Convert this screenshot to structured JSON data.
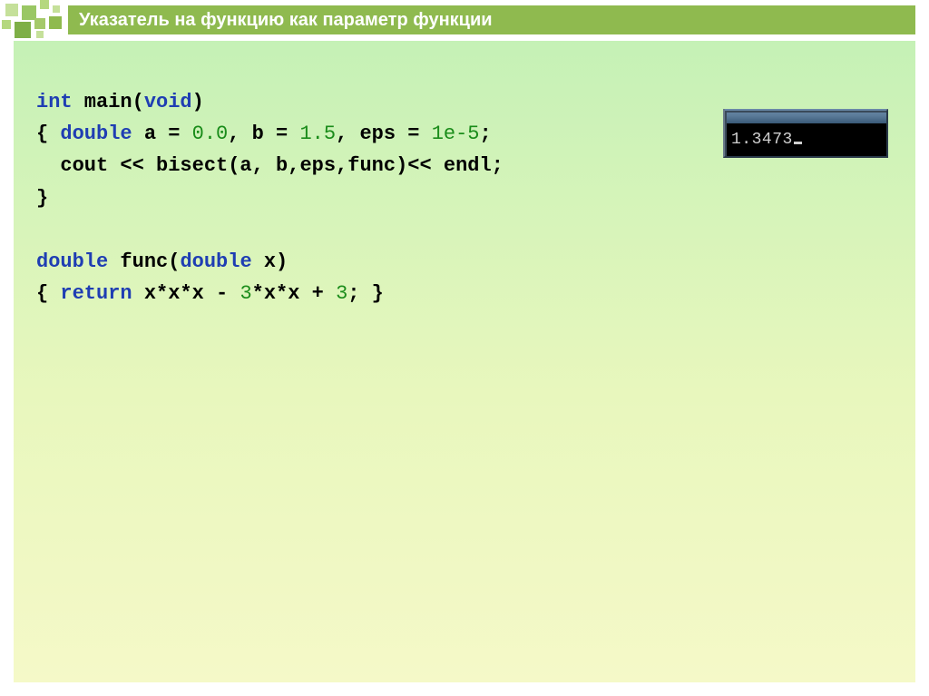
{
  "title": "Указатель на функцию как параметр функции",
  "code": {
    "l1": {
      "kw1": "int",
      "t1": " main(",
      "kw2": "void",
      "t2": ")"
    },
    "l2": {
      "t1": "{ ",
      "kw1": "double",
      "t2": " a = ",
      "n1": "0.0",
      "t3": ", b = ",
      "n2": "1.5",
      "t4": ", eps = ",
      "n3": "1e-5",
      "t5": ";"
    },
    "l3": "  cout << bisect(a, b,eps,func)<< endl;",
    "l4": "}",
    "l5": "",
    "l6": {
      "kw1": "double",
      "t1": " func(",
      "kw2": "double",
      "t2": " x)"
    },
    "l7": {
      "t1": "{ ",
      "kw1": "return",
      "t2": " x*x*x - ",
      "n1": "3",
      "t3": "*x*x + ",
      "n2": "3",
      "t4": "; }"
    }
  },
  "console": {
    "output": "1.3473"
  }
}
